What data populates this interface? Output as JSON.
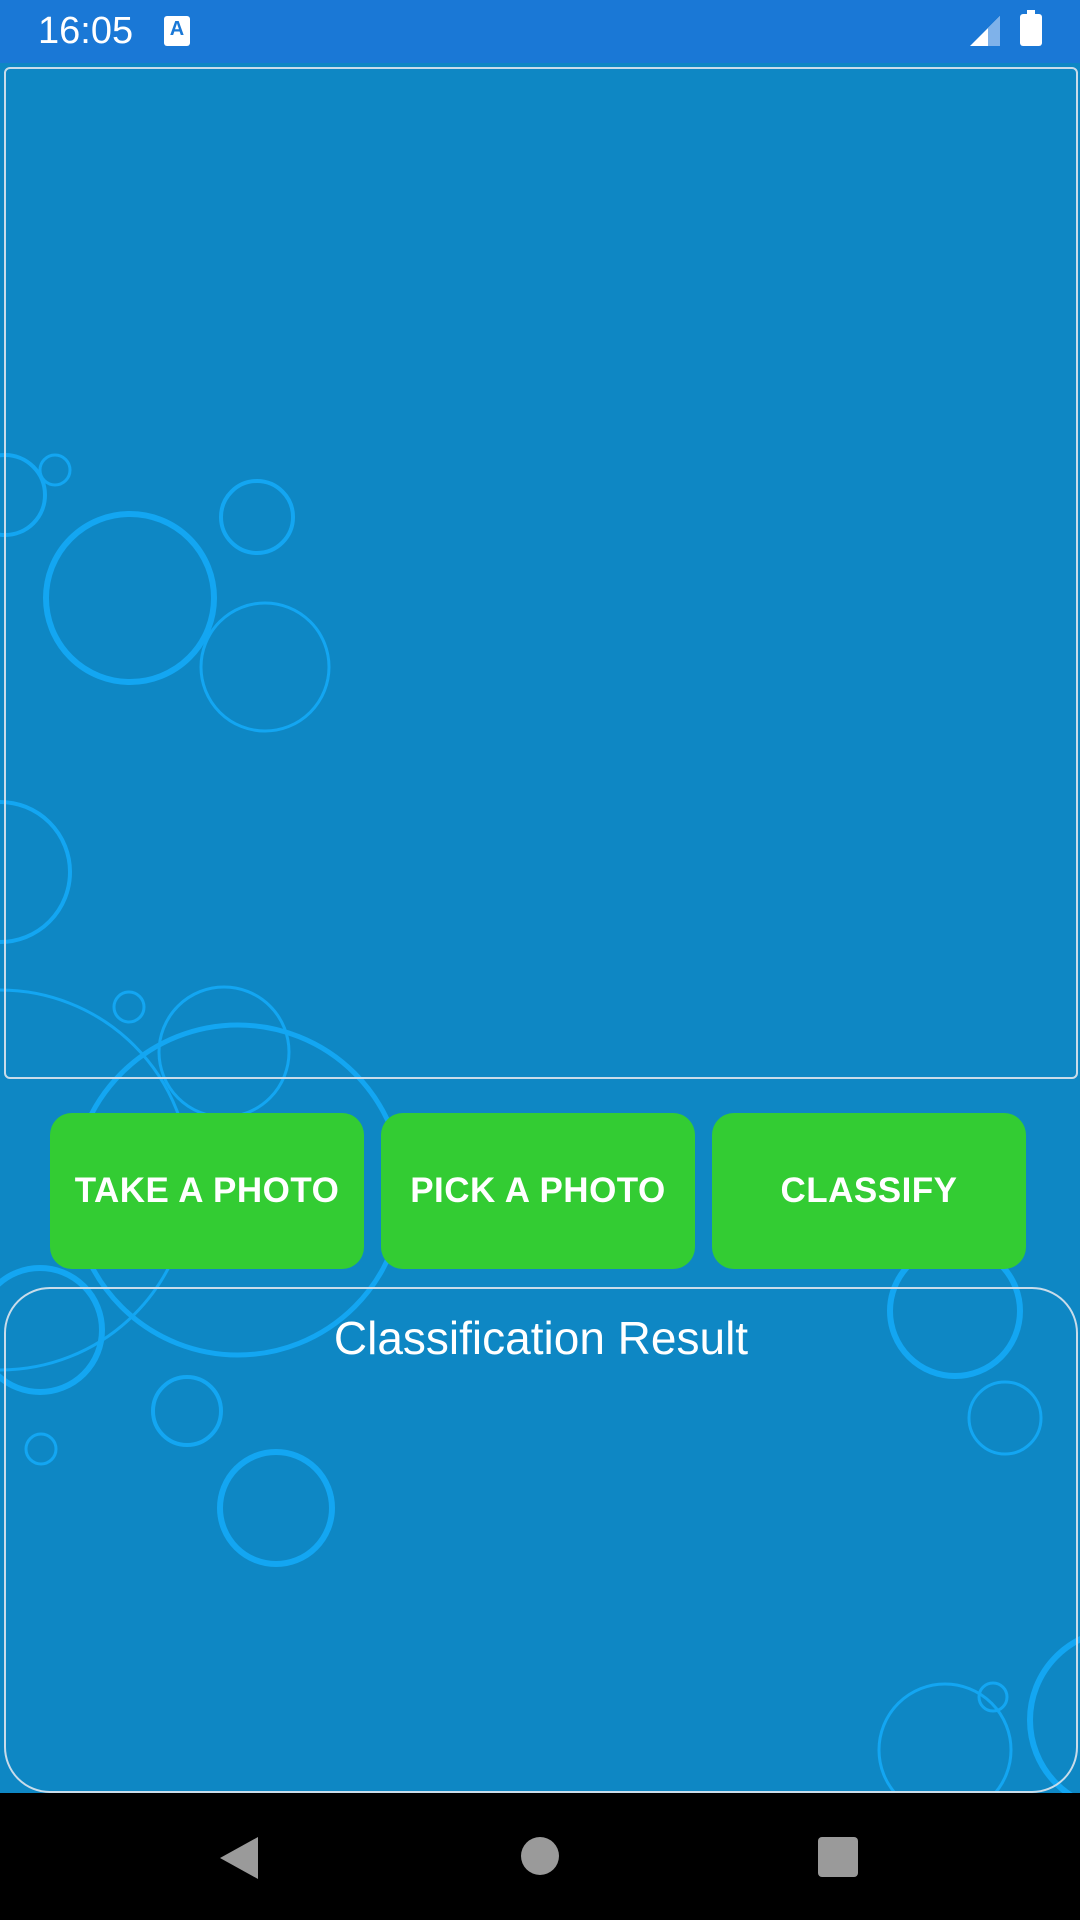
{
  "status_bar": {
    "time": "16:05",
    "notification_icon": "accessibility-a-icon",
    "signal_icon": "cell-signal-icon",
    "battery_icon": "battery-icon"
  },
  "image_preview": {
    "label": ""
  },
  "buttons": {
    "take_photo": "TAKE A PHOTO",
    "pick_photo": "PICK A PHOTO",
    "classify": "CLASSIFY"
  },
  "result": {
    "title": "Classification Result",
    "value": ""
  },
  "nav_bar": {
    "back_icon": "back-triangle-icon",
    "home_icon": "home-circle-icon",
    "recents_icon": "recents-square-icon"
  },
  "colors": {
    "status_bar": "#1a78d6",
    "background": "#0e87c4",
    "bubble_stroke": "#13a6f2",
    "button_green": "#33cc33",
    "frame_border": "#c9dcea",
    "nav_bar": "#000000"
  }
}
